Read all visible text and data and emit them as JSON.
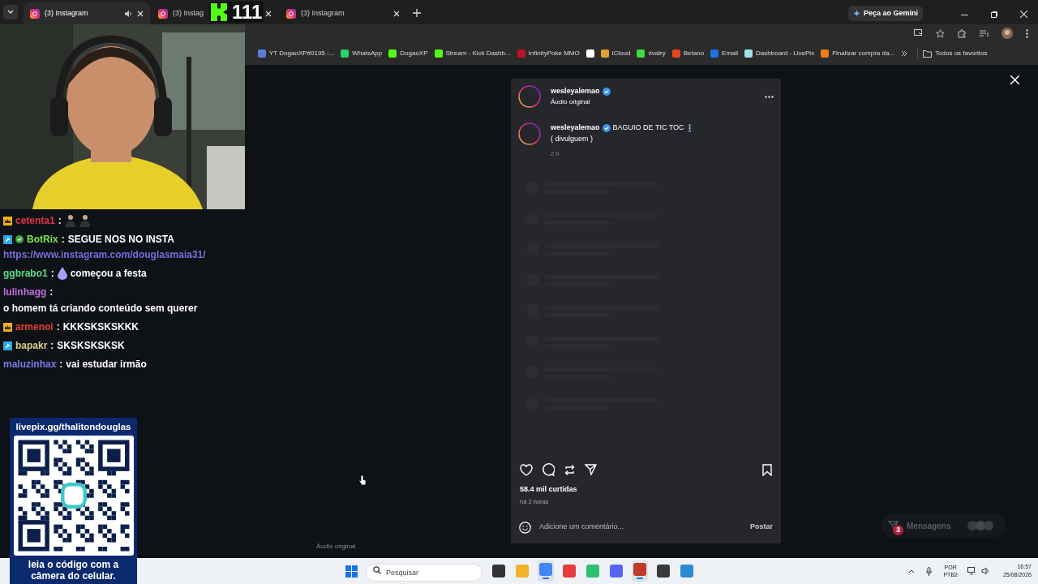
{
  "browser": {
    "tabs": [
      {
        "label": "(3) Instagram",
        "selected": true,
        "playing": true
      },
      {
        "label": "(3) Instag",
        "selected": false,
        "playing": false
      },
      {
        "label": "(3) Instagram",
        "selected": false,
        "playing": false
      }
    ],
    "gemini_button": "Peça ao Gemini",
    "bookmarks": [
      {
        "label": "YT DogaoXP#0195 -...",
        "color": "#5b7bd5"
      },
      {
        "label": "WhatsApp",
        "color": "#25d366"
      },
      {
        "label": "DogaoXP",
        "color": "#53fc18"
      },
      {
        "label": "Stream - Kick Dashb...",
        "color": "#53fc18"
      },
      {
        "label": "InfinityPoke MMO",
        "color": "#c0102a"
      },
      {
        "color": "#ffffff"
      },
      {
        "label": "iCloud",
        "color": "#e0a030"
      },
      {
        "label": "rivalry",
        "color": "#3ddc3d"
      },
      {
        "label": "Betano",
        "color": "#e8461e"
      },
      {
        "label": "Email",
        "color": "#1a73e8"
      },
      {
        "label": "Dashboard - LivePix",
        "color": "#9fe0e8"
      },
      {
        "label": "Finalizar compra da...",
        "color": "#f27a1a"
      }
    ],
    "all_bookmarks": "Todos os favoritos"
  },
  "kick_counter": "111",
  "chat": [
    {
      "user": "cetenta1",
      "color": "#e0334f",
      "badge": {
        "kind": "crown"
      },
      "verified": false,
      "sep": ":",
      "emotes": [
        {
          "kind": "figure"
        },
        {
          "kind": "figure"
        }
      ]
    },
    {
      "user": "BotRix",
      "color": "#7be04f",
      "badge": {
        "kind": "hammer"
      },
      "verified": true,
      "sep": ":",
      "text": "SEGUE NOS NO INSTA",
      "link": "https://www.instagram.com/douglasmaia31/"
    },
    {
      "user": "ggbrabo1",
      "color": "#5be08a",
      "verified": false,
      "sep": ":",
      "text": "começou a festa",
      "emotes": [
        {
          "kind": "drop"
        }
      ]
    },
    {
      "user": "lulinhagg",
      "color": "#c66ee0",
      "verified": false,
      "sep": ":",
      "text": "o homem tá criando conteúdo sem querer"
    },
    {
      "user": "armenoi",
      "color": "#e0432f",
      "badge": {
        "kind": "crown"
      },
      "verified": false,
      "sep": ":",
      "text": "KKKSKSKSKKK"
    },
    {
      "user": "bapakr",
      "color": "#d8d08a",
      "badge": {
        "kind": "hammer"
      },
      "verified": false,
      "sep": ":",
      "text": "SKSKSKSKSK"
    },
    {
      "user": "maluzinhax",
      "color": "#7b7be8",
      "verified": false,
      "sep": ":",
      "text": "vai estudar irmão"
    }
  ],
  "qr_card": {
    "title": "livepix.gg/thalitondouglas",
    "caption": "leia o código com a câmera do celular."
  },
  "background_label": "Áudio original",
  "post": {
    "author": "wesleyalemao",
    "verified": true,
    "subtitle": "Áudio original",
    "caption": {
      "author": "wesleyalemao",
      "verified": true,
      "text": "BAGUIO DE TIC TOC",
      "line2": "( divulguem )",
      "time": "2 h"
    },
    "likes": "58.4 mil curtidas",
    "ago": "há 2 horas",
    "comment": {
      "placeholder": "Adicione um comentário..."
    },
    "post_button": "Postar"
  },
  "messages_button": {
    "label": "Mensagens",
    "badge": "3"
  },
  "taskbar": {
    "search": {
      "placeholder": "Pesquisar"
    },
    "apps": [
      {
        "kind": "taskview",
        "active": false
      },
      {
        "kind": "folder",
        "active": false
      },
      {
        "kind": "chrome",
        "active": true
      },
      {
        "kind": "red",
        "active": false
      },
      {
        "kind": "green",
        "active": false
      },
      {
        "kind": "discord",
        "active": false
      },
      {
        "kind": "shield",
        "active": true
      },
      {
        "kind": "calculator",
        "active": false
      },
      {
        "kind": "notepad",
        "active": false
      }
    ],
    "language": "POR",
    "layout": "PTB2",
    "time": "16:57",
    "date": "25/08/2026"
  }
}
